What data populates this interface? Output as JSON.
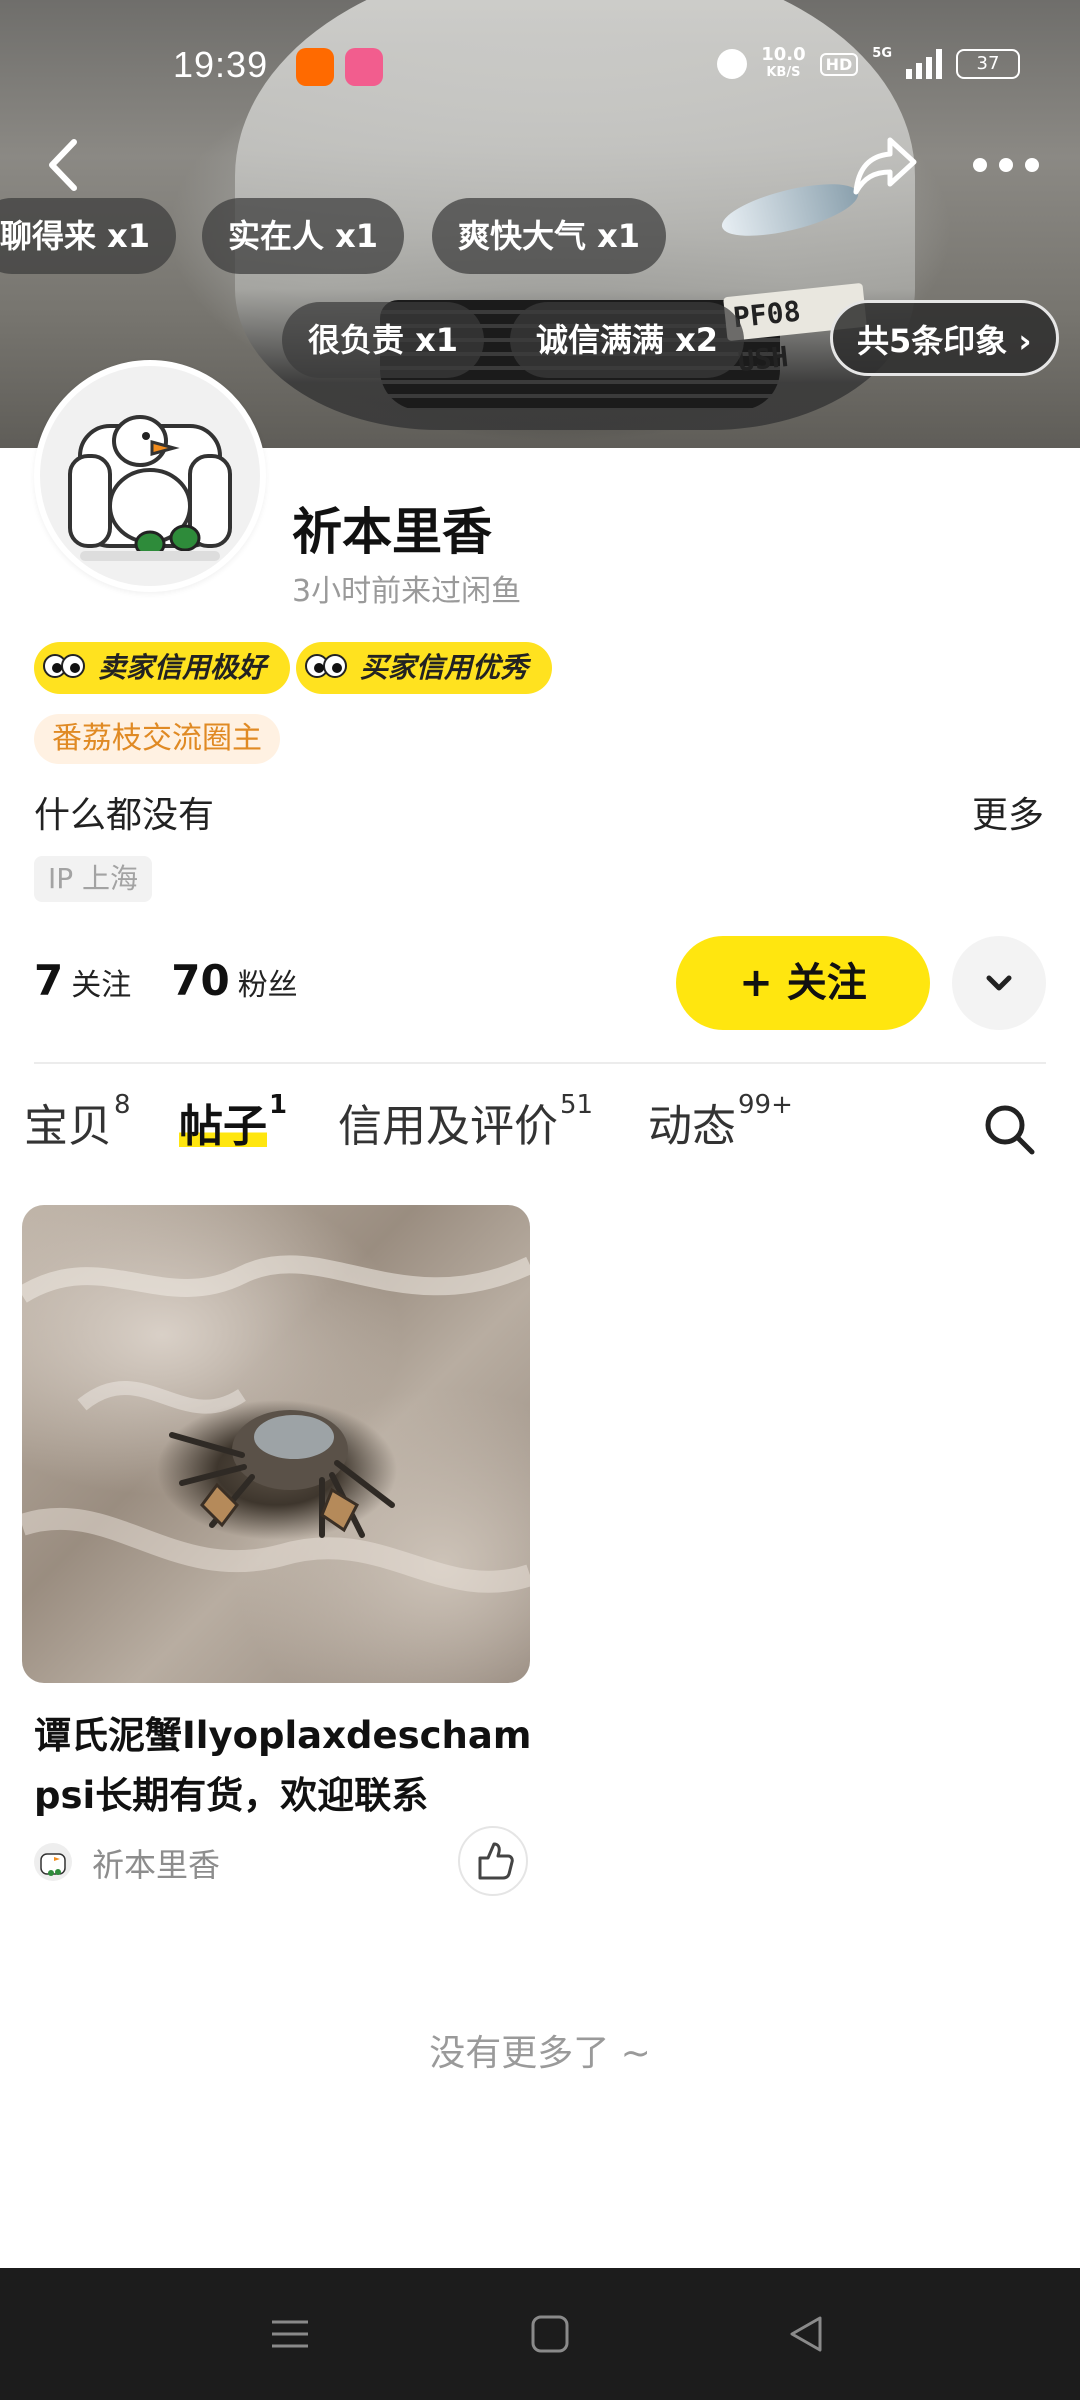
{
  "status_bar": {
    "time": "19:39",
    "net_speed_value": "10.0",
    "net_speed_unit": "KB/S",
    "hd": "HD",
    "network": "5G",
    "battery": "37"
  },
  "impressions": {
    "chips": [
      "聊得来 x1",
      "实在人 x1",
      "爽快大气 x1",
      "很负责 x1",
      "诚信满满 x2"
    ],
    "more_label": "共5条印象 ›"
  },
  "car_plate": "PF08 USH",
  "profile": {
    "name": "祈本里香",
    "last_seen": "3小时前来过闲鱼",
    "badges": [
      "卖家信用极好",
      "买家信用优秀"
    ],
    "circle_tag": "番荔枝交流圈主",
    "bio": "什么都没有",
    "bio_more": "更多",
    "ip": "IP 上海",
    "following_count": "7",
    "following_label": "关注",
    "followers_count": "70",
    "followers_label": "粉丝",
    "follow_button": "+ 关注"
  },
  "tabs": [
    {
      "label": "宝贝",
      "count": "8"
    },
    {
      "label": "帖子",
      "count": "1",
      "active": true
    },
    {
      "label": "信用及评价",
      "count": "51"
    },
    {
      "label": "动态",
      "count": "99+"
    }
  ],
  "post": {
    "title": "谭氏泥蟹Ilyoplaxdeschampsi长期有货，欢迎联系",
    "author": "祈本里香"
  },
  "footer": {
    "no_more": "没有更多了 ~"
  },
  "colors": {
    "brand_yellow": "#ffe60f",
    "tag_orange": "#e08a24",
    "tag_bg": "#fff1e2"
  },
  "icons": {
    "back": "chevron-left-icon",
    "share": "share-icon",
    "more": "more-dots-icon",
    "search": "search-icon",
    "like": "thumbs-up-icon",
    "dropdown": "chevron-down-icon"
  }
}
